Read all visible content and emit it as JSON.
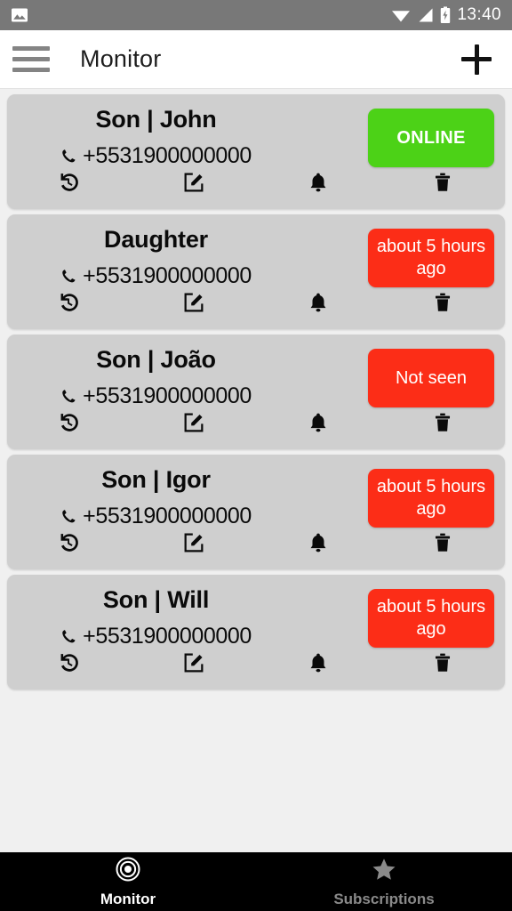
{
  "status_bar": {
    "time": "13:40",
    "icons": [
      "image-icon",
      "wifi-icon",
      "cellular-signal-icon",
      "battery-icon"
    ]
  },
  "app_bar": {
    "menu_icon": "hamburger-menu-icon",
    "title": "Monitor",
    "add_icon": "plus-icon"
  },
  "colors": {
    "online_green": "#4cd217",
    "offline_red": "#fc2d17",
    "card_gray": "#cfcfcf",
    "page_background": "#f0f0f0",
    "status_bar_gray": "#787878",
    "nav_background": "#000000"
  },
  "card_actions": [
    {
      "name": "history-icon",
      "label": "History"
    },
    {
      "name": "edit-icon",
      "label": "Edit"
    },
    {
      "name": "bell-icon",
      "label": "Notifications"
    },
    {
      "name": "trash-icon",
      "label": "Delete"
    }
  ],
  "contacts": [
    {
      "name": "Son | John",
      "phone": "+5531900000000",
      "status": "ONLINE",
      "status_state": "online"
    },
    {
      "name": "Daughter",
      "phone": "+5531900000000",
      "status": "about 5 hours ago",
      "status_state": "offline"
    },
    {
      "name": "Son | João",
      "phone": "+5531900000000",
      "status": "Not seen",
      "status_state": "offline"
    },
    {
      "name": "Son | Igor",
      "phone": "+5531900000000",
      "status": "about 5 hours ago",
      "status_state": "offline"
    },
    {
      "name": "Son | Will",
      "phone": "+5531900000000",
      "status": "about 5 hours ago",
      "status_state": "offline"
    }
  ],
  "bottom_nav": [
    {
      "label": "Monitor",
      "icon": "target-icon",
      "active": true
    },
    {
      "label": "Subscriptions",
      "icon": "star-icon",
      "active": false
    }
  ]
}
